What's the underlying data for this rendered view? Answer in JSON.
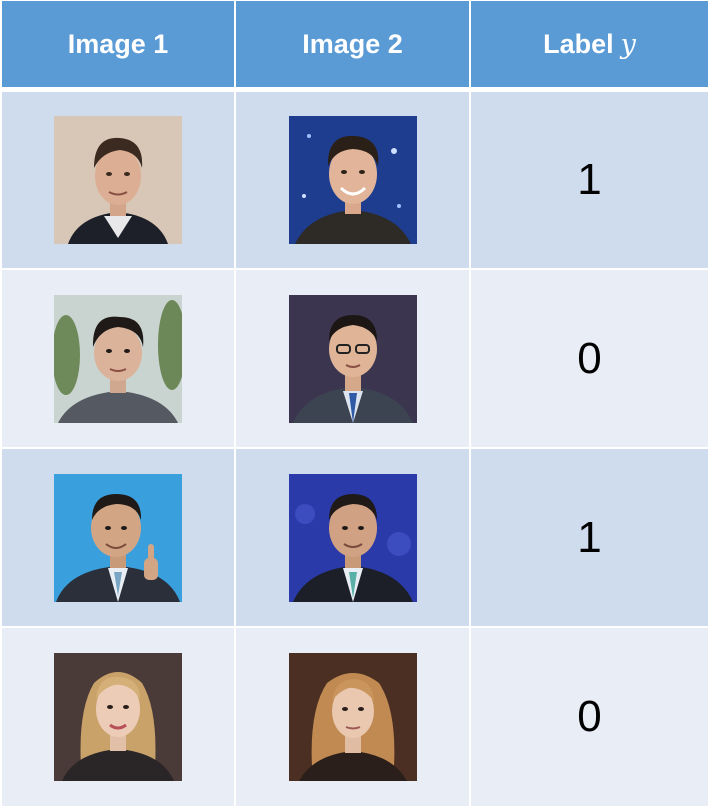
{
  "header": {
    "col1": "Image 1",
    "col2": "Image 2",
    "col3_text": "Label",
    "col3_var": "y"
  },
  "rows": [
    {
      "label": "1",
      "image1": "smiling man with swept dark hair, dark suit",
      "image2": "smiling man with dark hair, blue starry background"
    },
    {
      "label": "0",
      "image1": "man with short dark hair outdoors among trees",
      "image2": "man with glasses in dark suit, blue tie, purple background"
    },
    {
      "label": "1",
      "image1": "man in dark suit giving thumbs up, blue background",
      "image2": "man in dark suit with teal tie, blue background"
    },
    {
      "label": "0",
      "image1": "woman with long blonde hair, dark sheer top",
      "image2": "woman with wavy blonde hair, dark background"
    }
  ]
}
